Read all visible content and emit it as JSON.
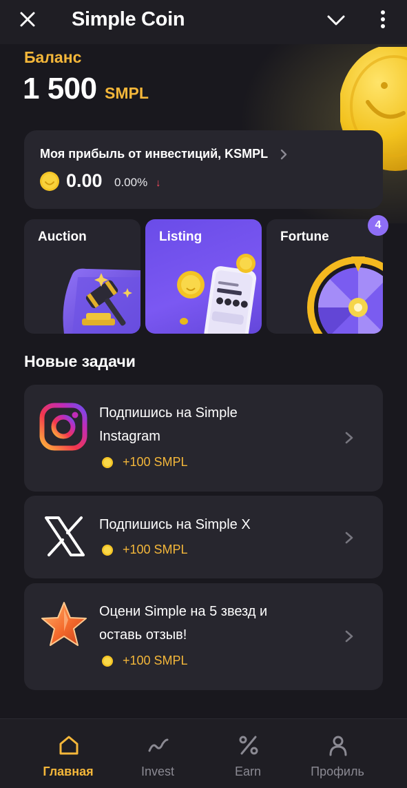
{
  "header": {
    "title": "Simple Coin",
    "close_icon": "close-icon",
    "dropdown_icon": "chevron-down-icon",
    "menu_icon": "more-vertical-icon"
  },
  "balance": {
    "label": "Баланс",
    "value": "1 500",
    "unit": "SMPL"
  },
  "profit": {
    "title": "Моя прибыль от инвестиций, KSMPL",
    "value": "0.00",
    "percent": "0.00%",
    "trend": "↓"
  },
  "tiles": {
    "auction": {
      "label": "Auction"
    },
    "listing": {
      "label": "Listing"
    },
    "fortune": {
      "label": "Fortune",
      "badge": "4"
    }
  },
  "tasks": {
    "title": "Новые задачи",
    "items": [
      {
        "icon": "instagram-icon",
        "title_line1": "Подпишись на Simple",
        "title_line2": "Instagram",
        "reward": "+100 SMPL"
      },
      {
        "icon": "x-logo-icon",
        "title_line1": "Подпишись на Simple X",
        "title_line2": "",
        "reward": "+100 SMPL"
      },
      {
        "icon": "star-icon",
        "title_line1": "Оцени Simple на 5 звезд и",
        "title_line2": "оставь отзыв!",
        "reward": "+100 SMPL"
      }
    ]
  },
  "nav": {
    "items": [
      {
        "label": "Главная",
        "icon": "home-icon",
        "active": true
      },
      {
        "label": "Invest",
        "icon": "chart-line-icon",
        "active": false
      },
      {
        "label": "Earn",
        "icon": "percent-icon",
        "active": false
      },
      {
        "label": "Профиль",
        "icon": "user-icon",
        "active": false
      }
    ]
  },
  "colors": {
    "background": "#19181e",
    "card": "#27262e",
    "accent": "#f4b73a",
    "purple": "#7b58f2",
    "negative": "#ff4b5f"
  }
}
